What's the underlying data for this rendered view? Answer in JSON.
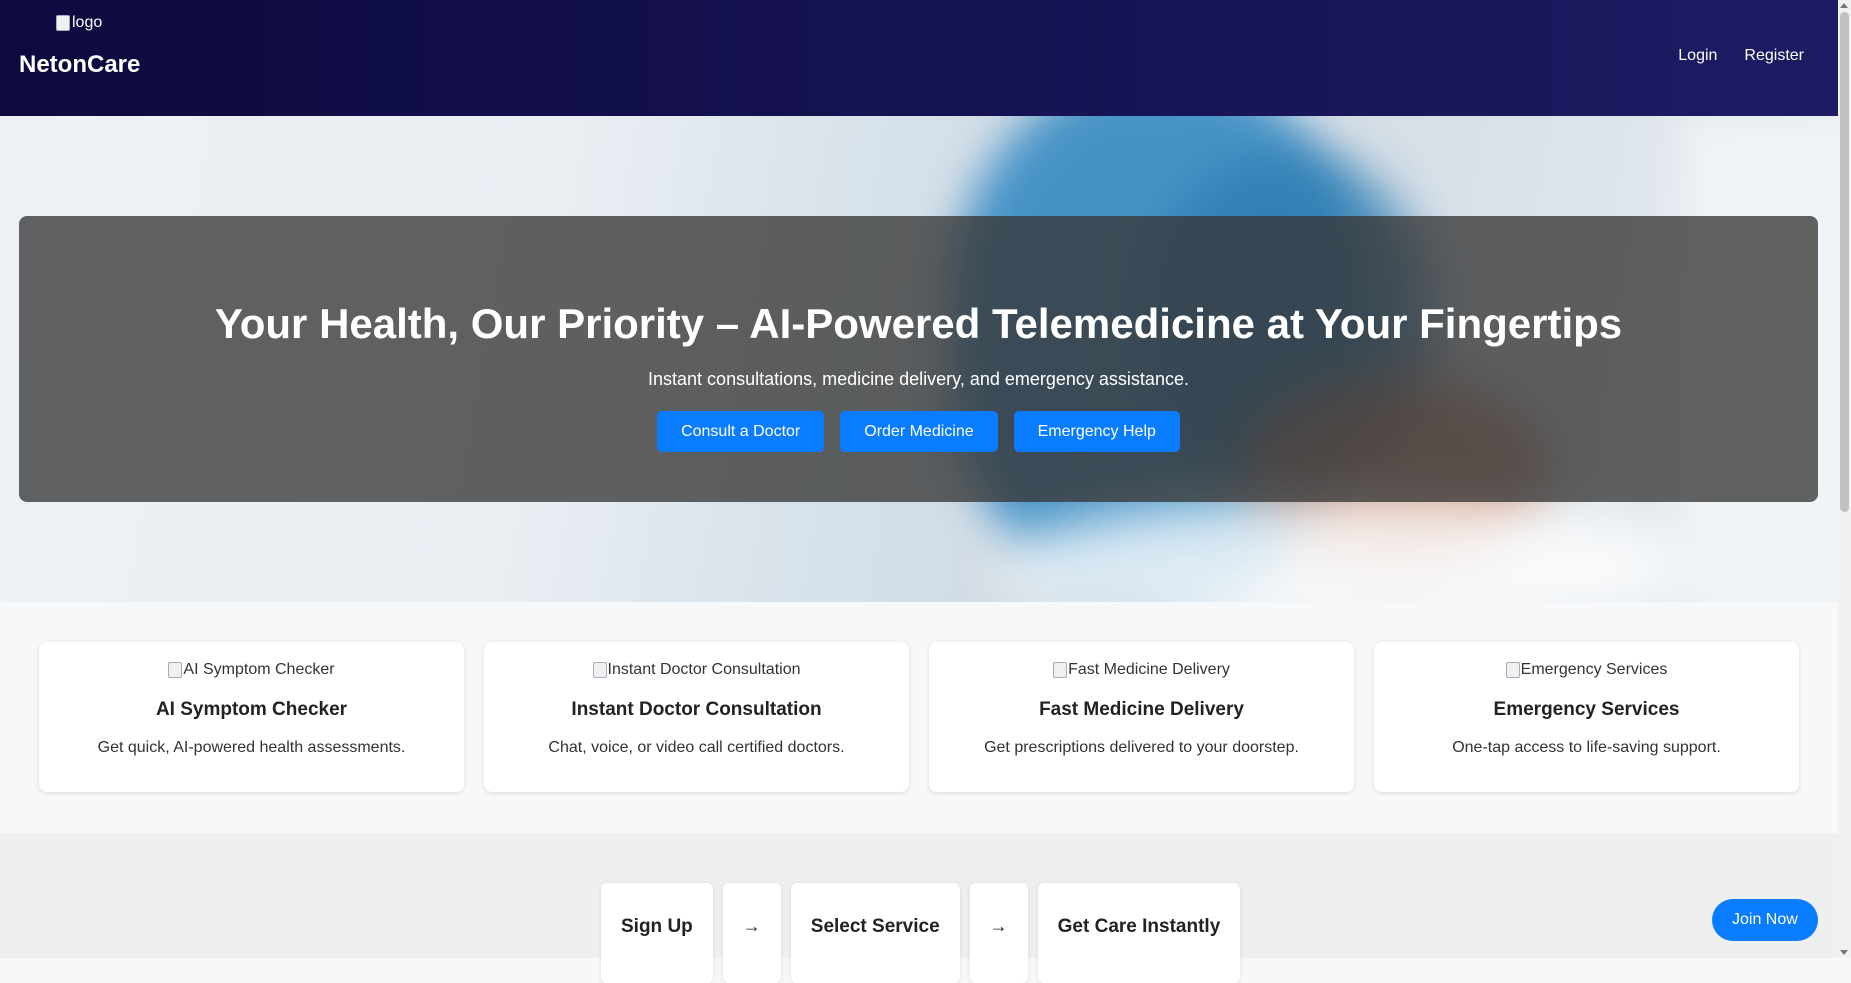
{
  "header": {
    "logo_alt": "logo",
    "brand": "NetonCare",
    "nav": {
      "login": "Login",
      "register": "Register"
    }
  },
  "hero": {
    "title": "Your Health, Our Priority – AI-Powered Telemedicine at Your Fingertips",
    "subtitle": "Instant consultations, medicine delivery, and emergency assistance.",
    "buttons": [
      "Consult a Doctor",
      "Order Medicine",
      "Emergency Help"
    ]
  },
  "features": [
    {
      "img_alt": "AI Symptom Checker",
      "title": "AI Symptom Checker",
      "desc": "Get quick, AI-powered health assessments."
    },
    {
      "img_alt": "Instant Doctor Consultation",
      "title": "Instant Doctor Consultation",
      "desc": "Chat, voice, or video call certified doctors."
    },
    {
      "img_alt": "Fast Medicine Delivery",
      "title": "Fast Medicine Delivery",
      "desc": "Get prescriptions delivered to your doorstep."
    },
    {
      "img_alt": "Emergency Services",
      "title": "Emergency Services",
      "desc": "One-tap access to life-saving support."
    }
  ],
  "steps": {
    "items": [
      "Sign Up",
      "Select Service",
      "Get Care Instantly"
    ],
    "arrow": "→"
  },
  "join_button": "Join Now",
  "colors": {
    "header_start": "#0d0a3f",
    "header_end": "#1d1b63",
    "accent": "#0a7cff"
  }
}
